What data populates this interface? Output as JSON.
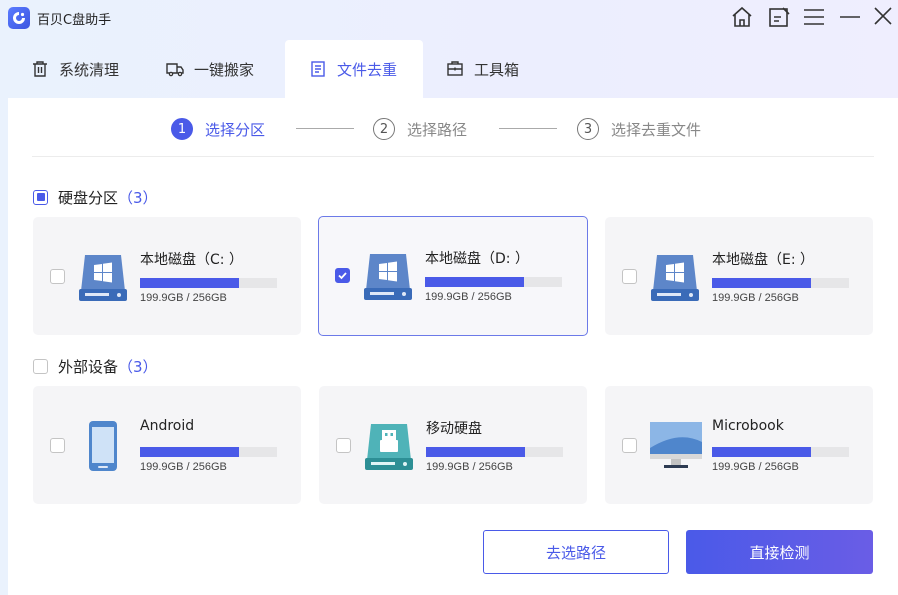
{
  "app": {
    "title": "百贝C盘助手"
  },
  "window_controls": [
    "home-icon",
    "feedback-icon",
    "menu-icon",
    "minimize-icon",
    "close-icon"
  ],
  "tabs": [
    {
      "label": "系统清理",
      "icon": "trash-icon"
    },
    {
      "label": "一键搬家",
      "icon": "truck-icon"
    },
    {
      "label": "文件去重",
      "icon": "document-icon",
      "active": true
    },
    {
      "label": "工具箱",
      "icon": "toolbox-icon"
    }
  ],
  "steps": [
    {
      "num": "1",
      "label": "选择分区",
      "active": true
    },
    {
      "num": "2",
      "label": "选择路径"
    },
    {
      "num": "3",
      "label": "选择去重文件"
    }
  ],
  "partitions": {
    "label": "硬盘分区",
    "count": "（3）",
    "items": [
      {
        "name": "本地磁盘（C: ）",
        "size": "199.9GB / 256GB",
        "usage": 0.72,
        "checked": false,
        "icon": "windows-drive-icon"
      },
      {
        "name": "本地磁盘（D: ）",
        "size": "199.9GB / 256GB",
        "usage": 0.72,
        "checked": true,
        "icon": "windows-drive-icon"
      },
      {
        "name": "本地磁盘（E: ）",
        "size": "199.9GB / 256GB",
        "usage": 0.72,
        "checked": false,
        "icon": "windows-drive-icon"
      }
    ]
  },
  "external": {
    "label": "外部设备",
    "count": "（3）",
    "items": [
      {
        "name": "Android",
        "size": "199.9GB / 256GB",
        "usage": 0.72,
        "checked": false,
        "icon": "phone-icon"
      },
      {
        "name": "移动硬盘",
        "size": "199.9GB / 256GB",
        "usage": 0.72,
        "checked": false,
        "icon": "usb-drive-icon"
      },
      {
        "name": "Microbook",
        "size": "199.9GB / 256GB",
        "usage": 0.72,
        "checked": false,
        "icon": "monitor-icon"
      }
    ]
  },
  "buttons": {
    "choose_path": "去选路径",
    "direct_scan": "直接检测"
  },
  "colors": {
    "accent": "#4a5ae8"
  }
}
